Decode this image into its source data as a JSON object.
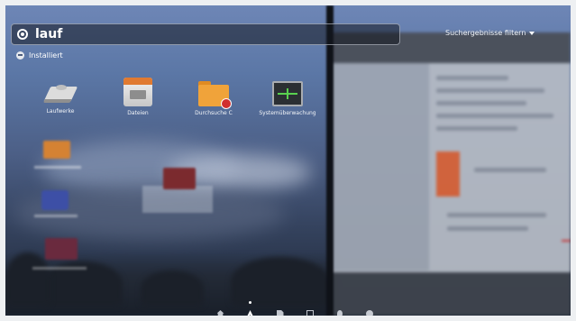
{
  "search": {
    "query": "lauf",
    "filter_label": "Suchergebnisse filtern"
  },
  "section": {
    "title": "Installiert",
    "icon": "installed-icon"
  },
  "results": [
    {
      "label": "Laufwerke",
      "icon": "drive-icon"
    },
    {
      "label": "Dateien",
      "icon": "file-manager-icon"
    },
    {
      "label": "Durchsuche C",
      "icon": "folder-icon"
    },
    {
      "label": "Systemüberwachung",
      "icon": "system-monitor-icon"
    }
  ],
  "lenses": [
    {
      "name": "home",
      "icon": "home-icon",
      "active": false
    },
    {
      "name": "applications",
      "icon": "applications-icon",
      "active": true
    },
    {
      "name": "files",
      "icon": "files-icon",
      "active": false
    },
    {
      "name": "video",
      "icon": "video-icon",
      "active": false
    },
    {
      "name": "music",
      "icon": "music-icon",
      "active": false
    },
    {
      "name": "photos",
      "icon": "photos-icon",
      "active": false
    }
  ],
  "colors": {
    "accent_orange": "#e07a31",
    "folder": "#f0a33a",
    "monitor_trace": "#59d04f"
  }
}
